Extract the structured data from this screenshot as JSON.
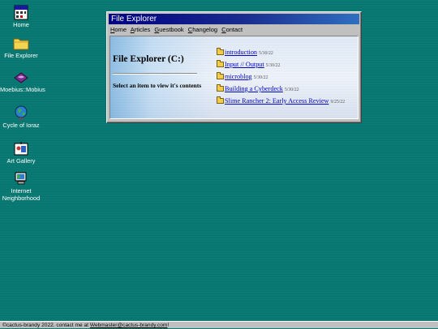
{
  "desktop": {
    "icons": [
      {
        "label": "Home",
        "icon": "home-calendar-icon"
      },
      {
        "label": "File Explorer",
        "icon": "folder-icon"
      },
      {
        "label": "Moebius::Mobius",
        "icon": "moebius-book-icon"
      },
      {
        "label": "Cycle of Ioraz",
        "icon": "globe-icon"
      },
      {
        "label": "Art Gallery",
        "icon": "art-gallery-icon"
      },
      {
        "label": "Internet Neighborhood",
        "icon": "network-computer-icon"
      }
    ]
  },
  "window": {
    "title": "File Explorer",
    "menu": [
      {
        "accel": "H",
        "rest": "ome"
      },
      {
        "accel": "A",
        "rest": "rticles"
      },
      {
        "accel": "G",
        "rest": "uestbook"
      },
      {
        "accel": "C",
        "rest": "hangelog"
      },
      {
        "accel": "C",
        "rest": "ontact"
      }
    ],
    "pane_title": "File Explorer (C:)",
    "pane_description": "Select an item to view it's contents",
    "files": [
      {
        "name": "introduction",
        "date": "5/30/22"
      },
      {
        "name": "Input // Output",
        "date": "5/30/22"
      },
      {
        "name": "microblog",
        "date": "5/30/22"
      },
      {
        "name": "Building a Cyberdeck",
        "date": "5/30/22"
      },
      {
        "name": "Slime Rancher 2: Early Access Review",
        "date": "9/25/22"
      }
    ]
  },
  "footer": {
    "text": "©cactus-brandy 2022. contact me at ",
    "link": "Webmaster@cactus-brandy.com",
    "suffix": "!"
  },
  "colors": {
    "desktop": "#0a7a74",
    "titlebar": "#000080",
    "link": "#0000c8"
  }
}
